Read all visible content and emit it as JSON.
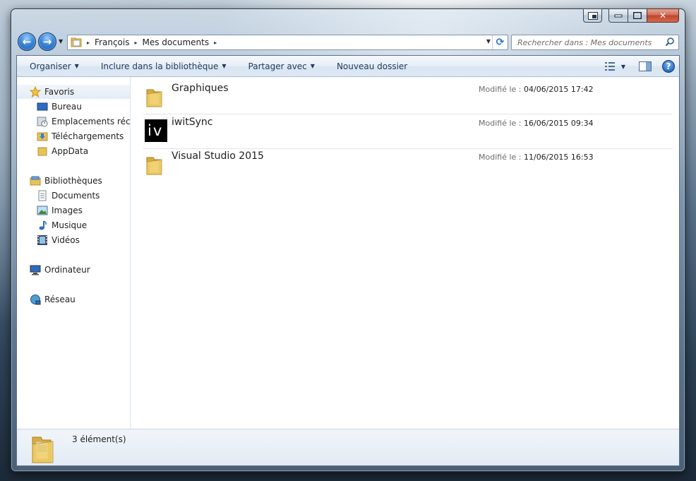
{
  "window": {
    "caption_buttons": {
      "snap_icon": "window-snap-icon",
      "minimize_icon": "minimize-icon",
      "maximize_icon": "maximize-icon",
      "close_icon": "close-icon",
      "minimize_glyph": "▬",
      "maximize_glyph": "▭",
      "close_glyph": "✕"
    }
  },
  "navigation": {
    "back_icon": "back-arrow-icon",
    "forward_icon": "forward-arrow-icon",
    "back_glyph": "←",
    "forward_glyph": "→",
    "recent_caret": "▼"
  },
  "address": {
    "crumbs": [
      "François",
      "Mes documents"
    ],
    "separator": "▸",
    "dropdown_glyph": "▼",
    "refresh_glyph": "⟳"
  },
  "search": {
    "placeholder": "Rechercher dans : Mes documents"
  },
  "toolbar": {
    "organize": "Organiser",
    "include_library": "Inclure dans la bibliothèque",
    "share_with": "Partager avec",
    "new_folder": "Nouveau dossier",
    "caret": "▼",
    "help_glyph": "?"
  },
  "sidebar": {
    "favorites": {
      "label": "Favoris",
      "items": [
        "Bureau",
        "Emplacements récents",
        "Téléchargements",
        "AppData"
      ]
    },
    "libraries": {
      "label": "Bibliothèques",
      "items": [
        "Documents",
        "Images",
        "Musique",
        "Vidéos"
      ]
    },
    "computer": {
      "label": "Ordinateur"
    },
    "network": {
      "label": "Réseau"
    }
  },
  "files": [
    {
      "name": "Graphiques",
      "modified_label": "Modifié le :",
      "modified": "04/06/2015 17:42",
      "icon": "folder-icon"
    },
    {
      "name": "iwitSync",
      "modified_label": "Modifié le :",
      "modified": "16/06/2015 09:34",
      "icon": "iwitsync-app-icon",
      "icon_text": "iv"
    },
    {
      "name": "Visual Studio 2015",
      "modified_label": "Modifié le :",
      "modified": "11/06/2015 16:53",
      "icon": "folder-icon"
    }
  ],
  "details": {
    "count": "3 élément(s)"
  },
  "colors": {
    "toolbar_text": "#1e395b",
    "nav_button": "#3b86d6",
    "close_button": "#c0442b",
    "folder": "#e8c25a"
  }
}
